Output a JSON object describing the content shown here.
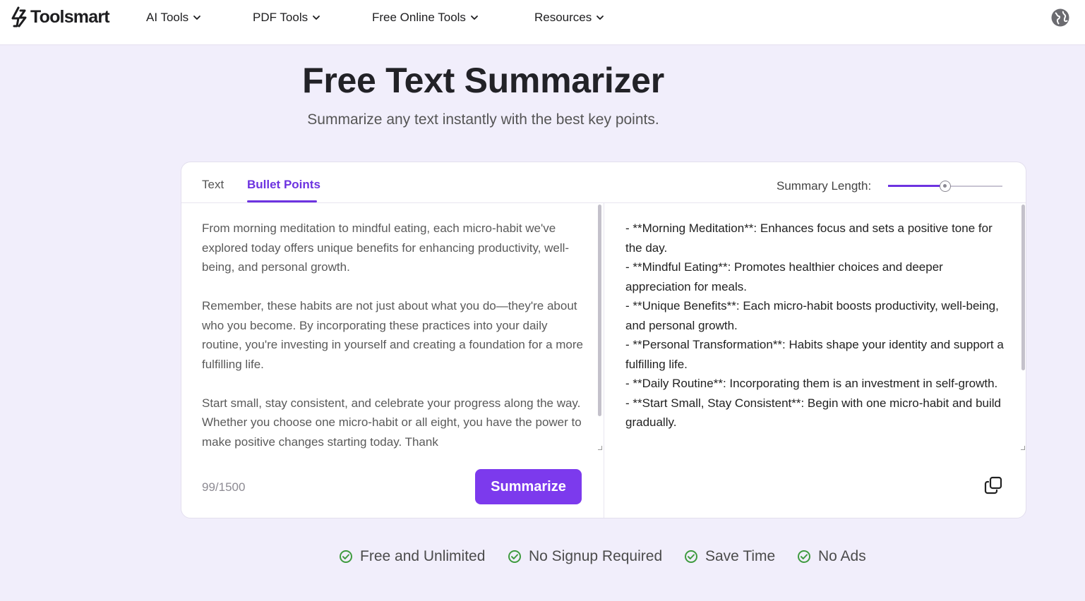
{
  "header": {
    "logo_text": "Toolsmart",
    "nav": [
      {
        "label": "AI Tools"
      },
      {
        "label": "PDF Tools"
      },
      {
        "label": "Free Online Tools"
      },
      {
        "label": "Resources"
      }
    ],
    "globe_icon": "globe-icon"
  },
  "hero": {
    "title": "Free Text Summarizer",
    "subtitle": "Summarize any text instantly with the best key points."
  },
  "tool": {
    "tabs": [
      {
        "label": "Text",
        "active": false
      },
      {
        "label": "Bullet Points",
        "active": true
      }
    ],
    "summary_length_label": "Summary Length:",
    "summary_length_value": 0.5,
    "input_text": "From morning meditation to mindful eating, each micro-habit we've explored today offers unique benefits for enhancing productivity, well-being, and personal growth.\n\nRemember, these habits are not just about what you do—they're about who you become. By incorporating these practices into your daily routine, you're investing in yourself and creating a foundation for a more fulfilling life.\n\nStart small, stay consistent, and celebrate your progress along the way. Whether you choose one micro-habit or all eight, you have the power to make positive changes starting today. Thank",
    "output_text": "- **Morning Meditation**: Enhances focus and sets a positive tone for the day.\n- **Mindful Eating**: Promotes healthier choices and deeper appreciation for meals.\n- **Unique Benefits**: Each micro-habit boosts productivity, well-being, and personal growth.\n- **Personal Transformation**: Habits shape your identity and support a fulfilling life.\n- **Daily Routine**: Incorporating them is an investment in self-growth.\n- **Start Small, Stay Consistent**: Begin with one micro-habit and build gradually.",
    "counter": "99/1500",
    "summarize_label": "Summarize",
    "copy_icon": "copy-icon"
  },
  "features": [
    {
      "label": "Free and Unlimited"
    },
    {
      "label": "No Signup Required"
    },
    {
      "label": "Save Time"
    },
    {
      "label": "No Ads"
    }
  ],
  "colors": {
    "accent": "#6d33e0",
    "button": "#7c3aed",
    "page_bg": "#f1eefb",
    "check_green": "#3f9b3f"
  }
}
